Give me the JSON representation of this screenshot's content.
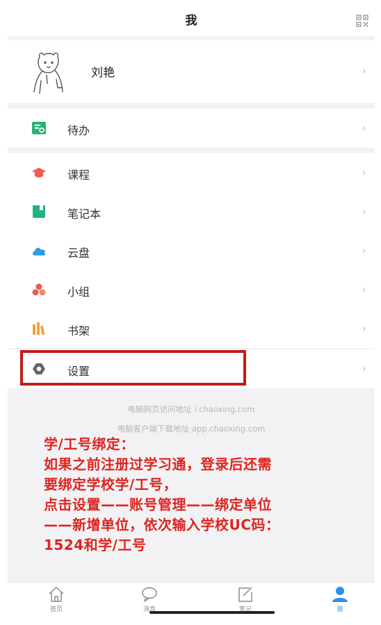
{
  "header": {
    "title": "我",
    "qr_icon": "qrcode-icon"
  },
  "profile": {
    "name": "刘艳",
    "avatar_icon": "sketch-avatar-icon"
  },
  "todo": {
    "label": "待办",
    "icon": "todo-icon",
    "color": "#2db07a"
  },
  "menu": [
    {
      "label": "课程",
      "icon": "graduation-cap-icon",
      "color": "#ef5a4b"
    },
    {
      "label": "笔记本",
      "icon": "notebook-icon",
      "color": "#21b37d"
    },
    {
      "label": "云盘",
      "icon": "cloud-icon",
      "color": "#2f9be8"
    },
    {
      "label": "小组",
      "icon": "group-icon",
      "color": "#ee5c4a"
    },
    {
      "label": "书架",
      "icon": "bookshelf-icon",
      "color": "#f1a43c"
    }
  ],
  "settings": {
    "label": "设置",
    "icon": "gear-icon"
  },
  "footer": {
    "web_url": "电脑网页访问地址 i.chaoxing.com",
    "client_url": "电脑客户端下载地址 app.chaoxing.com"
  },
  "note": {
    "lines": [
      "学/工号绑定：",
      "如果之前注册过学习通，登录后还需",
      "要绑定学校学/工号，",
      "点击设置——账号管理——绑定单位",
      "——新增单位，依次输入学校UC码：",
      "1524和学/工号"
    ],
    "color": "#e0231f"
  },
  "tabs": [
    {
      "label": "首页",
      "icon": "home-icon"
    },
    {
      "label": "消息",
      "icon": "message-icon"
    },
    {
      "label": "笔记",
      "icon": "note-edit-icon"
    },
    {
      "label": "我",
      "icon": "user-icon",
      "active": true
    }
  ],
  "colors": {
    "accent": "#2e8fe6",
    "highlight_border": "#c21a1a"
  }
}
